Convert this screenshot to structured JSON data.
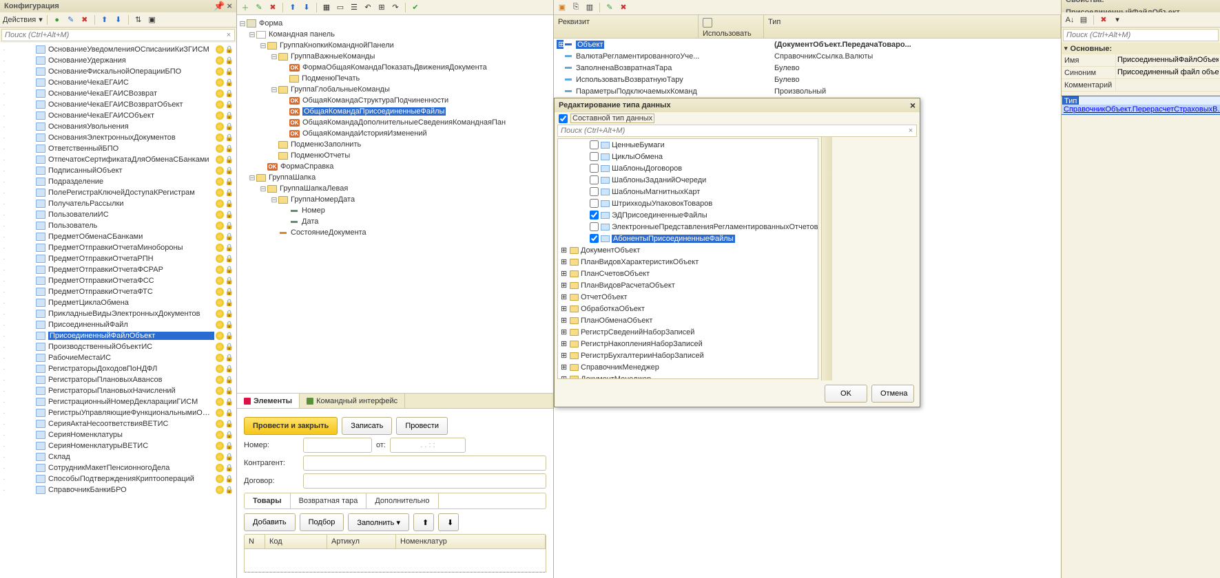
{
  "left": {
    "title": "Конфигурация",
    "actions_btn": "Действия",
    "search_placeholder": "Поиск (Ctrl+Alt+M)",
    "selected": "ПрисоединенныйФайлОбъект",
    "items": [
      "ОснованиеУведомленияОСписанииКиЗГИСМ",
      "ОснованиеУдержания",
      "ОснованиеФискальнойОперацииБПО",
      "ОснованиеЧекаЕГАИС",
      "ОснованиеЧекаЕГАИСВозврат",
      "ОснованиеЧекаЕГАИСВозвратОбъект",
      "ОснованиеЧекаЕГАИСОбъект",
      "ОснованияУвольнения",
      "ОснованияЭлектронныхДокументов",
      "ОтветственныйБПО",
      "ОтпечатокСертификатаДляОбменаСБанками",
      "ПодписанныйОбъект",
      "Подразделение",
      "ПолеРегистраКлючейДоступаКРегистрам",
      "ПолучательРассылки",
      "ПользователиИС",
      "Пользователь",
      "ПредметОбменаСБанками",
      "ПредметОтправкиОтчетаМинобороны",
      "ПредметОтправкиОтчетаРПН",
      "ПредметОтправкиОтчетаФСРАР",
      "ПредметОтправкиОтчетаФСС",
      "ПредметОтправкиОтчетаФТС",
      "ПредметЦиклаОбмена",
      "ПрикладныеВидыЭлектронныхДокументов",
      "ПрисоединенныйФайл",
      "ПрисоединенныйФайлОбъект",
      "ПроизводственныйОбъектИС",
      "РабочиеМестаИС",
      "РегистраторыДоходовПоНДФЛ",
      "РегистраторыПлановыхАвансов",
      "РегистраторыПлановыхНачислений",
      "РегистрационныйНомерДекларацииГИСМ",
      "РегистрыУправляющиеФункциональнымиОпция...",
      "СерияАктаНесоответствияВЕТИС",
      "СерияНоменклатуры",
      "СерияНоменклатурыВЕТИС",
      "Склад",
      "СотрудникМакетПенсионногоДела",
      "СпособыПодтвержденияКриптоопераций",
      "СправочникБанкиБРО"
    ]
  },
  "center": {
    "root": "Форма",
    "cmdpanel": "Командная панель",
    "group_btns": "ГруппаКнопкиКоманднойПанели",
    "group_important": "ГруппаВажныеКоманды",
    "form_general": "ФормаОбщаяКомандаПоказатьДвиженияДокумента",
    "submenu_print": "ПодменюПечать",
    "group_global": "ГруппаГлобальныеКоманды",
    "gc1": "ОбщаяКомандаСтруктураПодчиненности",
    "gc2": "ОбщаяКомандаПрисоединенныеФайлы",
    "gc3": "ОбщаяКомандаДополнительныеСведенияКоманднаяПан",
    "gc4": "ОбщаяКомандаИсторияИзменений",
    "submenu_fill": "ПодменюЗаполнить",
    "submenu_reports": "ПодменюОтчеты",
    "form_help": "ФормаСправка",
    "group_header": "ГруппаШапка",
    "group_header_left": "ГруппаШапкаЛевая",
    "group_numdate": "ГруппаНомерДата",
    "f_num": "Номер",
    "f_date": "Дата",
    "f_state": "СостояниеДокумента",
    "tab_elements": "Элементы",
    "tab_cmd_iface": "Командный интерфейс",
    "btn_post_close": "Провести и закрыть",
    "btn_write": "Записать",
    "btn_post": "Провести",
    "lbl_number": "Номер:",
    "lbl_from": "от:",
    "lbl_contragent": "Контрагент:",
    "lbl_contract": "Договор:",
    "tab_goods": "Товары",
    "tab_rettare": "Возвратная тара",
    "tab_extra": "Дополнительно",
    "btn_add": "Добавить",
    "btn_pick": "Подбор",
    "btn_fill": "Заполнить",
    "th_n": "N",
    "th_code": "Код",
    "th_art": "Артикул",
    "th_nomen": "Номенклатур"
  },
  "req": {
    "h1": "Реквизит",
    "h2": "Использовать всегда",
    "h3": "Тип",
    "r_obj": "Объект",
    "t_obj": "(ДокументОбъект.ПередачаТоваро...",
    "r_cur": "ВалютаРегламентированногоУче...",
    "t_cur": "СправочникСсылка.Валюты",
    "r_tare": "ЗаполненаВозвратнаяТара",
    "t_bool": "Булево",
    "r_ret": "ИспользоватьВозвратнуюТару",
    "r_params": "ПараметрыПодключаемыхКоманд",
    "t_params": "Произвольный"
  },
  "modal": {
    "title": "Редактирование типа данных",
    "composite": "Составной тип данных",
    "search_placeholder": "Поиск (Ctrl+Alt+M)",
    "ok": "OK",
    "cancel": "Отмена",
    "items_checked": [
      "ЭДПрисоединенныеФайлы",
      "АбонентыПрисоединенныеФайлы"
    ],
    "items_tbl": [
      "ЦенныеБумаги",
      "ЦиклыОбмена",
      "ШаблоныДоговоров",
      "ШаблоныЗаданийОчереди",
      "ШаблоныМагнитныхКарт",
      "ШтрихкодыУпаковокТоваров",
      "ЭДПрисоединенныеФайлы",
      "ЭлектронныеПредставленияРегламентированныхОтчетов",
      "АбонентыПрисоединенныеФайлы"
    ],
    "items_folder": [
      "ДокументОбъект",
      "ПланВидовХарактеристикОбъект",
      "ПланСчетовОбъект",
      "ПланВидовРасчетаОбъект",
      "ОтчетОбъект",
      "ОбработкаОбъект",
      "ПланОбменаОбъект",
      "РегистрСведенийНаборЗаписей",
      "РегистрНакопленияНаборЗаписей",
      "РегистрБухгалтерииНаборЗаписей",
      "СправочникМенеджер",
      "ДокументМенеджер"
    ]
  },
  "prop": {
    "title_prefix": "Свойства: ",
    "title_obj": "ПрисоединенныйФайлОбъект",
    "search_placeholder": "Поиск (Ctrl+Alt+M)",
    "section": "Основные:",
    "name_lbl": "Имя",
    "name_val": "ПрисоединенныйФайлОбъект",
    "syn_lbl": "Синоним",
    "syn_val": "Присоединенный файл объект",
    "comment_lbl": "Комментарий",
    "type_lbl": "Тип",
    "type_val": "СправочникОбъект.ПерерасчетСтраховыхВ..."
  },
  "date_mask": ". . : :"
}
